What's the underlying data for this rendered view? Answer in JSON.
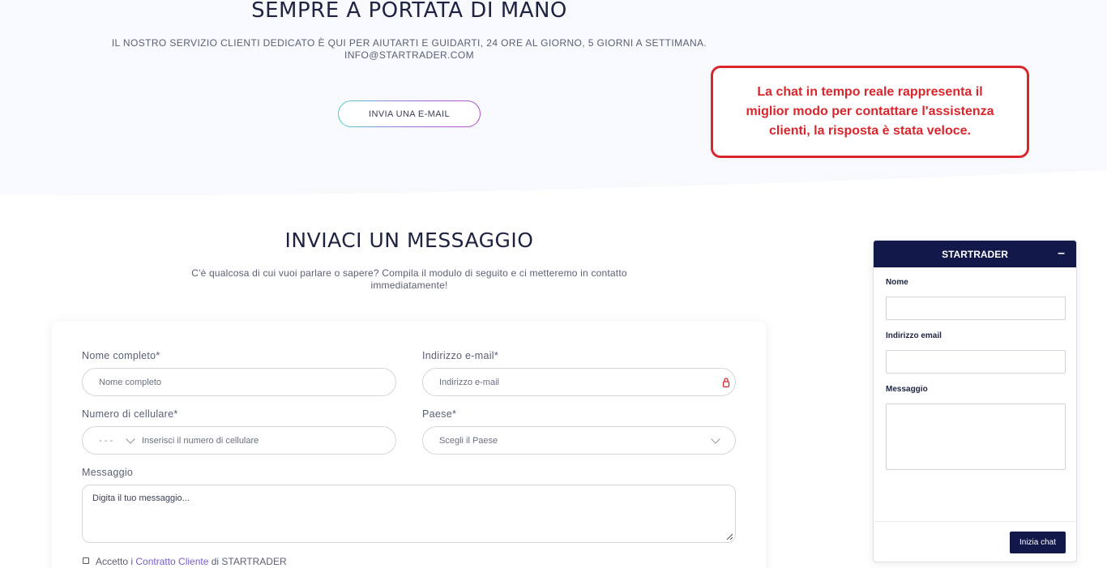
{
  "hero": {
    "title": "SEMPRE A PORTATA DI MANO",
    "subtitle": "IL NOSTRO SERVIZIO CLIENTI DEDICATO È QUI PER AIUTARTI E GUIDARTI, 24 ORE AL GIORNO, 5 GIORNI A SETTIMANA.",
    "email": "INFO@STARTRADER.COM",
    "email_button": "INVIA UNA E-MAIL"
  },
  "callout": {
    "text": "La chat in tempo reale rappresenta il miglior modo per contattare l'assistenza clienti, la risposta è stata veloce."
  },
  "contact": {
    "title": "INVIACI UN MESSAGGIO",
    "subtitle": "C'è qualcosa di cui vuoi parlare o sapere? Compila il modulo di seguito e ci metteremo in contatto immediatamente!",
    "fields": {
      "name_label": "Nome completo*",
      "name_placeholder": "Nome completo",
      "email_label": "Indirizzo e-mail*",
      "email_placeholder": "Indirizzo e-mail",
      "phone_label": "Numero di cellulare*",
      "phone_code": "- - -",
      "phone_placeholder": "Inserisci il numero di cellulare",
      "country_label": "Paese*",
      "country_placeholder": "Scegli il Paese",
      "message_label": "Messaggio",
      "message_placeholder": "Digita il tuo messaggio..."
    },
    "accept_prefix": "Accetto i ",
    "accept_link": "Contratto Cliente",
    "accept_suffix": " di STARTRADER"
  },
  "chat": {
    "title": "STARTRADER",
    "minimize": "–",
    "name_label": "Nome",
    "email_label": "Indirizzo email",
    "message_label": "Messaggio",
    "start_button": "Inizia chat"
  },
  "colors": {
    "navy": "#13184a",
    "callout_red": "#d9262c",
    "link_purple": "#7b5cc7"
  }
}
